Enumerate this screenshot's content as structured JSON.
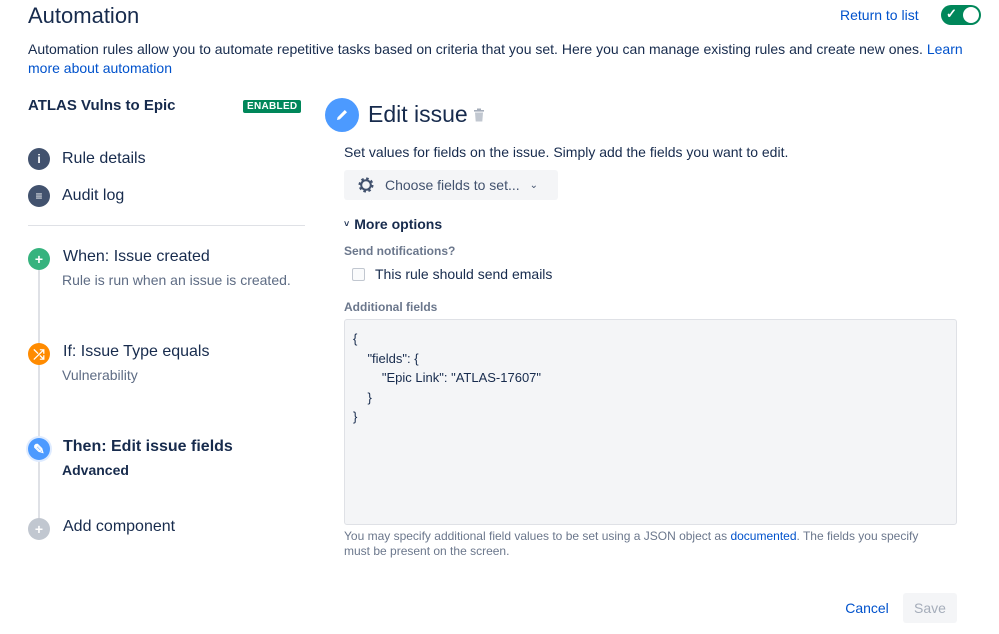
{
  "header": {
    "title": "Automation",
    "return_link": "Return to list",
    "toggle_state": "on",
    "toggle_check": "✓"
  },
  "intro": {
    "text": "Automation rules allow you to automate repetitive tasks based on criteria that you set. Here you can manage existing rules and create new ones. ",
    "link": "Learn more about automation"
  },
  "rule": {
    "name": "ATLAS Vulns to Epic",
    "status_badge": "ENABLED"
  },
  "nav": {
    "items": [
      {
        "label": "Rule details",
        "icon": "info-icon",
        "glyph": "i"
      },
      {
        "label": "Audit log",
        "icon": "list-icon",
        "glyph": "≡"
      }
    ]
  },
  "steps": [
    {
      "title": "When: Issue created",
      "subtitle": "Rule is run when an issue is created.",
      "icon": "plus-icon",
      "glyph": "+",
      "color": "#36b37e"
    },
    {
      "title": "If: Issue Type equals",
      "subtitle": "Vulnerability",
      "icon": "shuffle-icon",
      "glyph": "⤮",
      "color": "#ff8b00"
    },
    {
      "title": "Then: Edit issue fields",
      "subtitle": "Advanced",
      "icon": "pencil-icon",
      "glyph": "✎",
      "color": "#4c9aff"
    },
    {
      "title": "Add component",
      "icon": "plus-icon",
      "glyph": "+",
      "color": "#c1c7d0"
    }
  ],
  "panel": {
    "title": "Edit issue",
    "description": "Set values for fields on the issue. Simply add the fields you want to edit.",
    "choose_fields": "Choose fields to set...",
    "chevron_down": "⌄",
    "more_options": "More options",
    "more_options_chevron": "˅",
    "send_notifications_label": "Send notifications?",
    "send_emails_label": "This rule should send emails",
    "send_emails_checked": false,
    "additional_fields_label": "Additional fields",
    "json_lines": [
      "{",
      "    \"fields\": {",
      "        \"Epic Link\": \"ATLAS-17607\"",
      "    }",
      "}"
    ],
    "help_text_before": "You may specify additional field values to be set using a JSON object as ",
    "help_link": "documented",
    "help_text_after": ". The fields you specify must be present on the screen."
  },
  "footer": {
    "cancel": "Cancel",
    "save": "Save"
  },
  "colors": {
    "accent": "#0052cc",
    "enabled": "#00875a",
    "edit_icon": "#4c9aff"
  }
}
